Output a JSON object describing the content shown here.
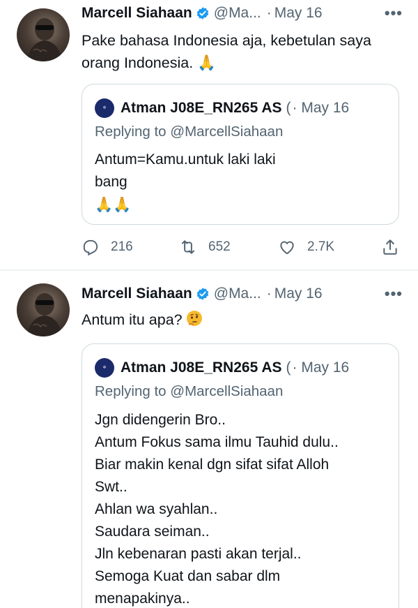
{
  "tweets": [
    {
      "author": {
        "name": "Marcell Siahaan",
        "handle": "@Ma...",
        "date": "May 16"
      },
      "text": {
        "line1": "Pake bahasa Indonesia aja, kebetulan saya",
        "line2": "orang Indonesia."
      },
      "emoji": "pray-emoji",
      "quote": {
        "author": {
          "name": "Atman J08E_RN265 AS",
          "paren": "(",
          "date": "· May 16"
        },
        "replying_to": "Replying to @MarcellSiahaan",
        "lines": [
          "Antum=Kamu.untuk laki laki",
          "bang"
        ],
        "emoji": "pray-pray-emoji"
      },
      "actions": {
        "replies": "216",
        "retweets": "652",
        "likes": "2.7K"
      }
    },
    {
      "author": {
        "name": "Marcell Siahaan",
        "handle": "@Ma...",
        "date": "May 16"
      },
      "text": {
        "line1": "Antum itu apa?"
      },
      "emoji": "thinking-emoji",
      "quote": {
        "author": {
          "name": "Atman J08E_RN265 AS",
          "paren": "(",
          "date": "· May 16"
        },
        "replying_to": "Replying to @MarcellSiahaan",
        "lines": [
          "Jgn didengerin Bro..",
          "Antum Fokus sama ilmu Tauhid dulu..",
          "Biar makin kenal dgn sifat sifat  Alloh",
          "Swt..",
          "Ahlan wa syahlan..",
          "Saudara seiman..",
          "Jln kebenaran pasti akan terjal..",
          "Semoga Kuat dan sabar dlm",
          "menapakinya.."
        ]
      }
    }
  ],
  "more_icon": "more-horizontal-icon",
  "colors": {
    "verified": "#1d9bf0",
    "muted": "#536471",
    "border": "#cfd9de",
    "text": "#0f1419"
  }
}
